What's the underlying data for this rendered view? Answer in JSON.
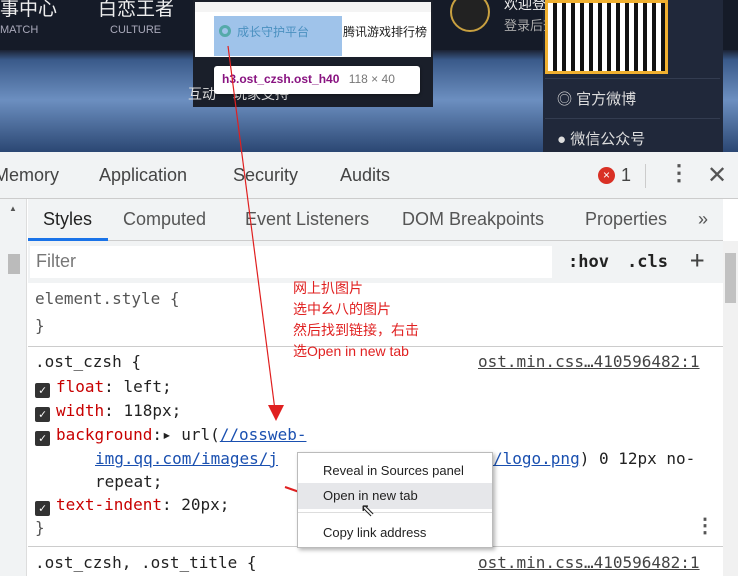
{
  "site": {
    "nav": [
      {
        "cn": "事中心",
        "en": "MATCH"
      },
      {
        "cn": "白恋王者",
        "en": "CULTURE"
      }
    ],
    "popup": {
      "highlight_label": "成长守护平台",
      "next_label": "腾讯游戏排行榜",
      "bottom_left": "互动",
      "bottom_mid": "玩家支持"
    },
    "tooltip": {
      "selector": "h3.ost_czsh.ost_h40",
      "size": "118 × 40"
    },
    "login": {
      "title": "欢迎登录",
      "subtitle": "登录后查看游戏战绩"
    },
    "side_buttons": [
      "官方微博",
      "微信公众号"
    ]
  },
  "devtools": {
    "tabs": [
      "Memory",
      "Application",
      "Security",
      "Audits"
    ],
    "error_count": "1",
    "subtabs": [
      "Styles",
      "Computed",
      "Event Listeners",
      "DOM Breakpoints",
      "Properties",
      "»"
    ],
    "filter_placeholder": "Filter",
    "hov": ":hov",
    "cls": ".cls",
    "plus": "+",
    "rules": {
      "element_style": "element.style {",
      "close": "}",
      "r1_selector": ".ost_czsh {",
      "r1_source": "ost.min.css…410596482:1",
      "float_prop": "float",
      "float_val": " left;",
      "width_prop": "width",
      "width_val": " 118px;",
      "bg_prop": "background",
      "bg_url_pre": "▸ url(",
      "bg_url1": "//ossweb-",
      "bg_url2": "img.qq.com/images/j",
      "bg_url3": "/logo.png",
      "bg_rest": ") 0 12px no-",
      "bg_rest2": "repeat;",
      "ti_prop": "text-indent",
      "ti_val": " 20px;",
      "r2_selector": ".ost_czsh, .ost_title {",
      "r2_source": "ost.min.css…410596482:1"
    }
  },
  "annotation": [
    "网上扒图片",
    "选中幺八的图片",
    "然后找到链接，右击",
    "选Open in new tab"
  ],
  "context_menu": [
    "Reveal in Sources panel",
    "Open in new tab",
    "Copy link address"
  ],
  "colors": {
    "accent": "#1a73e8",
    "annotation": "#e02020",
    "property": "#c80000"
  }
}
